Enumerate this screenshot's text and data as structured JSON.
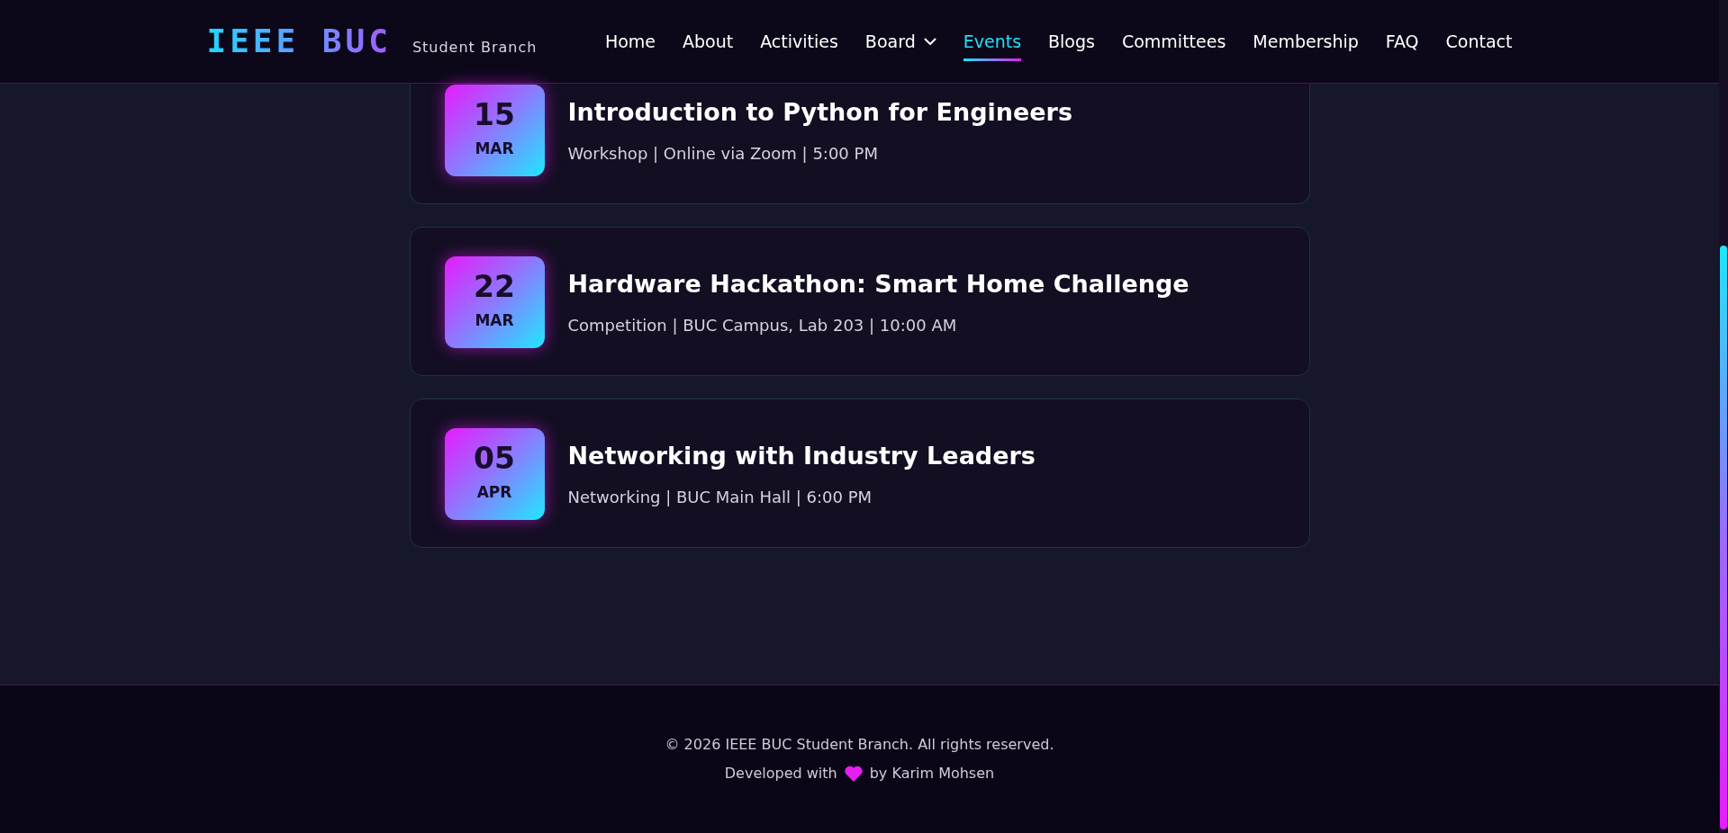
{
  "header": {
    "logo": "IEEE BUC",
    "tagline": "Student Branch",
    "nav": [
      {
        "label": "Home",
        "kind": "link",
        "selected": false
      },
      {
        "label": "About",
        "kind": "link",
        "selected": false
      },
      {
        "label": "Activities",
        "kind": "link",
        "selected": false
      },
      {
        "label": "Board",
        "kind": "dropdown",
        "selected": false
      },
      {
        "label": "Events",
        "kind": "link",
        "selected": true
      },
      {
        "label": "Blogs",
        "kind": "link",
        "selected": false
      },
      {
        "label": "Committees",
        "kind": "link",
        "selected": false
      },
      {
        "label": "Membership",
        "kind": "link",
        "selected": false
      },
      {
        "label": "FAQ",
        "kind": "link",
        "selected": false
      },
      {
        "label": "Contact",
        "kind": "link",
        "selected": false
      }
    ]
  },
  "events": [
    {
      "day": "15",
      "month": "MAR",
      "title": "Introduction to Python for Engineers",
      "meta": "Workshop | Online via Zoom | 5:00 PM"
    },
    {
      "day": "22",
      "month": "MAR",
      "title": "Hardware Hackathon: Smart Home Challenge",
      "meta": "Competition | BUC Campus, Lab 203 | 10:00 AM"
    },
    {
      "day": "05",
      "month": "APR",
      "title": "Networking with Industry Leaders",
      "meta": "Networking | BUC Main Hall | 6:00 PM"
    }
  ],
  "footer": {
    "copyright": "© 2026 IEEE BUC Student Branch. All rights reserved.",
    "credit": {
      "before": "Developed with",
      "after": "by Karim Mohsen"
    }
  }
}
